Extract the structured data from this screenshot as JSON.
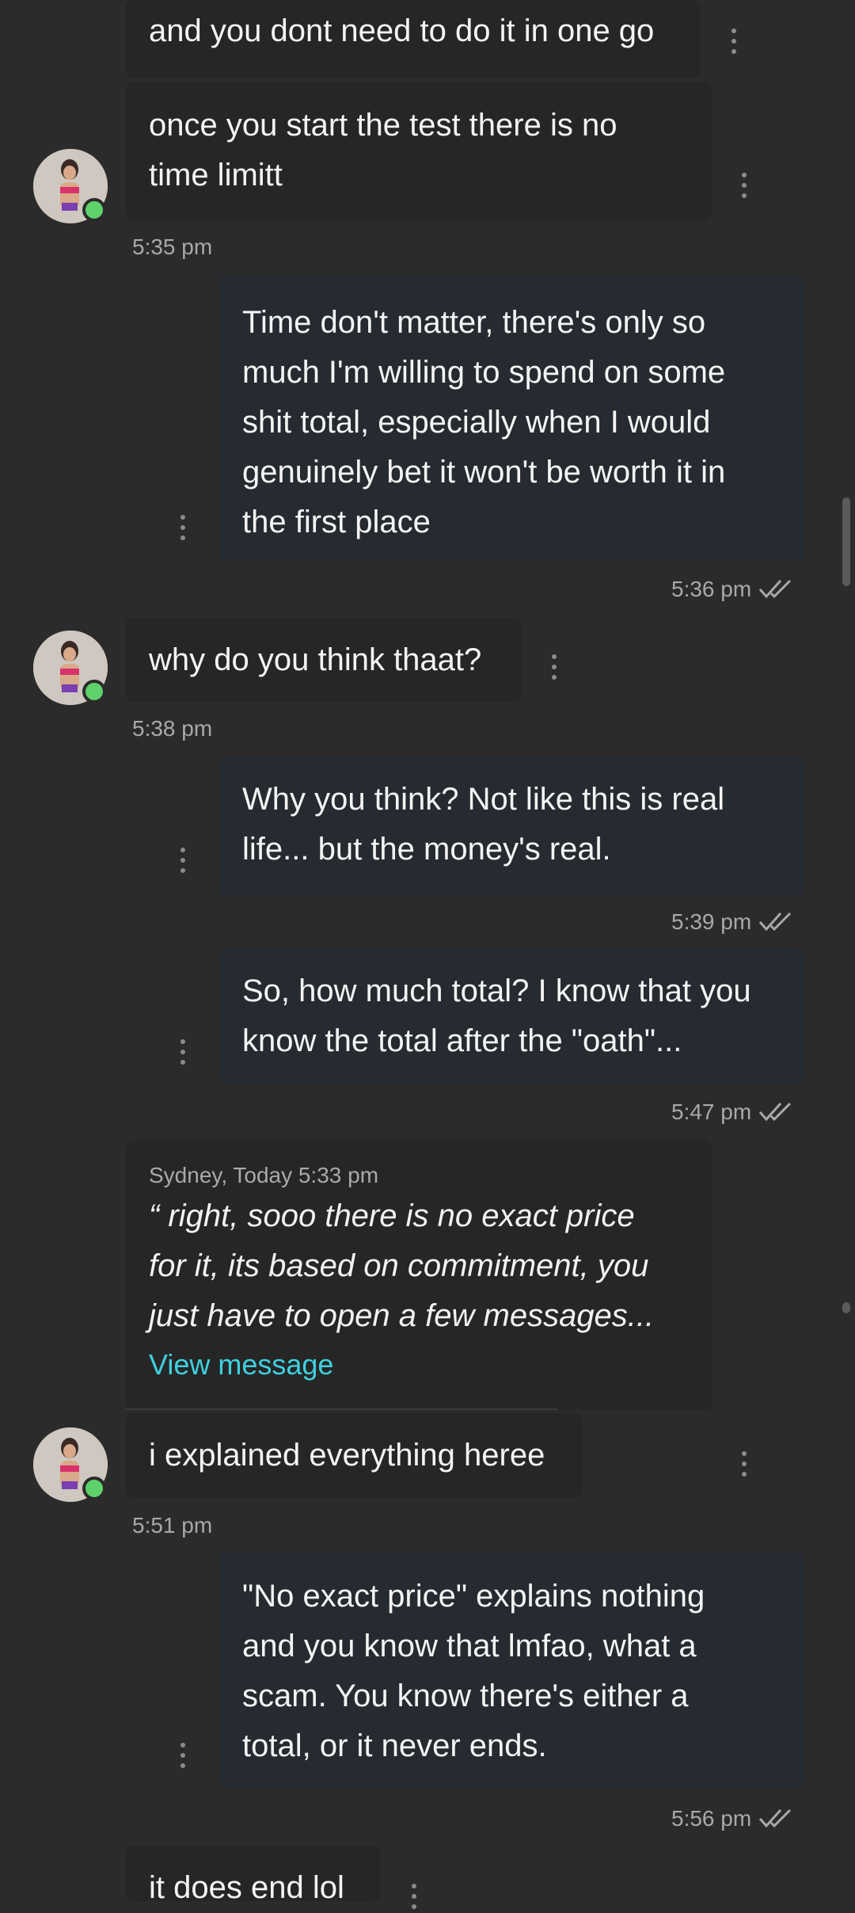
{
  "messages": [
    {
      "lines": [
        "and you dont need to do it in one go"
      ]
    },
    {
      "lines": [
        "once you start the test there is no",
        "time limitt"
      ]
    },
    {
      "lines": [
        "Time don't matter, there's only so",
        "much I'm willing to spend on some",
        "shit total, especially when I would",
        "genuinely bet it won't be worth it in",
        "the first place"
      ]
    },
    {
      "lines": [
        "why do you think thaat?"
      ]
    },
    {
      "lines": [
        "Why you think? Not like this is real",
        "life... but the money's real."
      ]
    },
    {
      "lines": [
        "So, how much total? I know that you",
        "know the total after the \"oath\"..."
      ]
    },
    {
      "lines": [
        "i explained everything heree"
      ]
    },
    {
      "lines": [
        "\"No exact price\" explains nothing",
        "and you know that lmfao, what a",
        "scam. You know there's either a",
        "total, or it never ends."
      ]
    },
    {
      "lines": [
        "it does end lol"
      ]
    }
  ],
  "quote": {
    "meta": "Sydney, Today 5:33 pm",
    "lines": [
      "“ right, sooo there is no exact price",
      "for it, its based on commitment, you",
      "just have to open a few messages..."
    ],
    "link": "View message"
  },
  "times": [
    "5:35 pm",
    "5:36 pm",
    "5:38 pm",
    "5:39 pm",
    "5:47 pm",
    "5:51 pm",
    "5:56 pm"
  ],
  "colors": {
    "background": "#2b2b2b",
    "incoming": "#262626",
    "outgoing": "#262b31",
    "link": "#3fd0e0",
    "online": "#5ed16b"
  }
}
